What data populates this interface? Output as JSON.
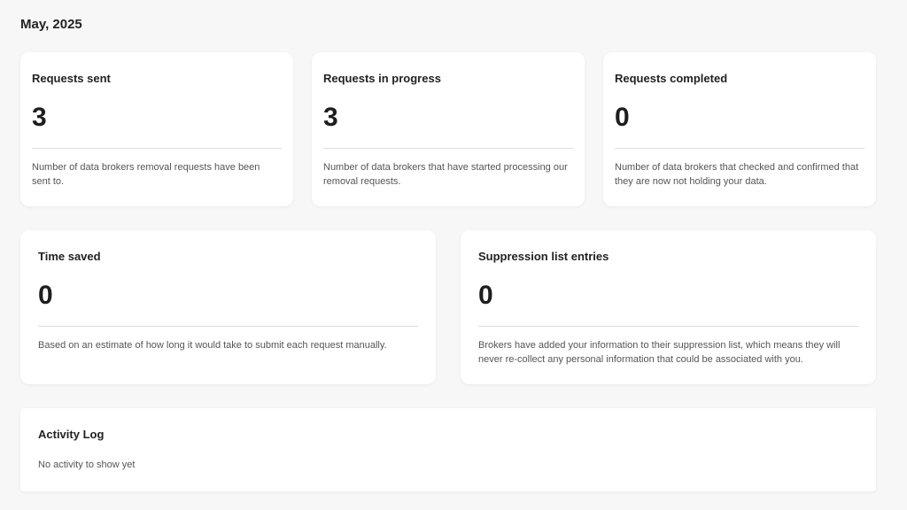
{
  "period": "May, 2025",
  "stats": {
    "sent": {
      "title": "Requests sent",
      "value": "3",
      "description": "Number of data brokers removal requests have been sent to."
    },
    "in_progress": {
      "title": "Requests in progress",
      "value": "3",
      "description": "Number of data brokers that have started processing our removal requests."
    },
    "completed": {
      "title": "Requests completed",
      "value": "0",
      "description": "Number of data brokers that checked and confirmed that they are now not holding your data."
    },
    "time_saved": {
      "title": "Time saved",
      "value": "0",
      "description": "Based on an estimate of how long it would take to submit each request manually."
    },
    "suppression": {
      "title": "Suppression list entries",
      "value": "0",
      "description": "Brokers have added your information to their suppression list, which means they will never re-collect any personal information that could be associated with you."
    }
  },
  "activity_log": {
    "title": "Activity Log",
    "empty_message": "No activity to show yet"
  }
}
